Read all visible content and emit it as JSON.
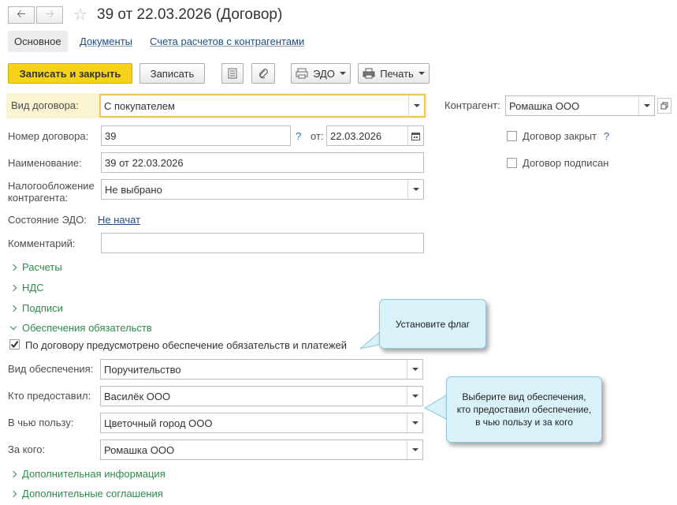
{
  "header": {
    "title": "39 от 22.03.2026 (Договор)",
    "back_icon": "arrow-left-icon",
    "forward_icon": "arrow-right-icon",
    "favorite_icon": "star-icon"
  },
  "tabs": [
    {
      "label": "Основное"
    },
    {
      "label": "Документы"
    },
    {
      "label": "Счета расчетов с контрагентами"
    }
  ],
  "toolbar": {
    "save_close_label": "Записать и закрыть",
    "save_label": "Записать",
    "edo_label": "ЭДО",
    "print_label": "Печать"
  },
  "form": {
    "contract_type_label": "Вид договора:",
    "contract_type_value": "С покупателем",
    "counterparty_label": "Контрагент:",
    "counterparty_value": "Ромашка ООО",
    "number_label": "Номер договора:",
    "number_value": "39",
    "question_mark": "?",
    "date_from_label": "от:",
    "date_value": "22.03.2026",
    "closed_label": "Договор закрыт",
    "signed_label": "Договор подписан",
    "name_label": "Наименование:",
    "name_value": "39 от 22.03.2026",
    "tax_label_line1": "Налогообложение",
    "tax_label_line2": "контрагента:",
    "tax_value": "Не выбрано",
    "edo_status_label": "Состояние ЭДО:",
    "edo_status_value": "Не начат",
    "comment_label": "Комментарий:",
    "comment_value": ""
  },
  "groups": {
    "payments": "Расчеты",
    "vat": "НДС",
    "signatures": "Подписи",
    "security": "Обеспечения обязательств",
    "additional_info": "Дополнительная информация",
    "additional_agreements": "Дополнительные соглашения"
  },
  "security": {
    "checkbox_label": "По договору предусмотрено обеспечение обязательств и платежей",
    "checked": true,
    "type_label": "Вид обеспечения:",
    "type_value": "Поручительство",
    "provider_label": "Кто предоставил:",
    "provider_value": "Василёк ООО",
    "beneficiary_label": "В чью пользу:",
    "beneficiary_value": "Цветочный город ООО",
    "for_whom_label": "За кого:",
    "for_whom_value": "Ромашка ООО"
  },
  "callouts": {
    "set_flag": "Установите флаг",
    "choose_line1": "Выберите вид обеспечения,",
    "choose_line2": "кто предоставил обеспечение,",
    "choose_line3": "в чью пользу и за кого"
  },
  "colors": {
    "primary_button": "#f7d21b",
    "group_header": "#2e8a4a",
    "link": "#1f4f82",
    "callout_bg": "#d9f1f9",
    "focus_border": "#f0c850"
  }
}
